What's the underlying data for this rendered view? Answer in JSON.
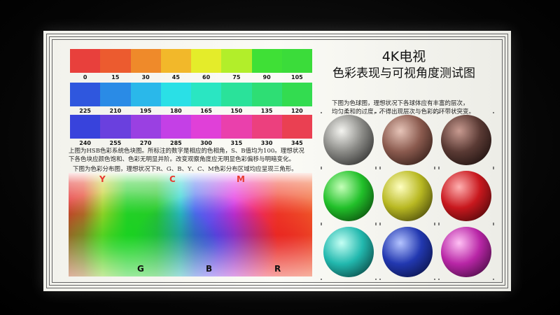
{
  "chart": {
    "title_line1": "4K电视",
    "title_line2": "色彩表现与可视角度测试图",
    "hue_rows": [
      {
        "labels": [
          "0",
          "15",
          "30",
          "45",
          "60",
          "75",
          "90",
          "105"
        ],
        "colors": [
          "#e8403c",
          "#ec5b2f",
          "#ef8a2a",
          "#f2b82a",
          "#e4ec2a",
          "#b2ee2a",
          "#3fe036",
          "#3bdc3a"
        ]
      },
      {
        "labels": [
          "225",
          "210",
          "195",
          "180",
          "165",
          "150",
          "135",
          "120"
        ],
        "colors": [
          "#2f57de",
          "#2a8be6",
          "#2ab8ea",
          "#2ae0e6",
          "#2ae6c2",
          "#2ae29a",
          "#2ede74",
          "#33dc50"
        ]
      },
      {
        "labels": [
          "240",
          "255",
          "270",
          "285",
          "300",
          "315",
          "330",
          "345"
        ],
        "colors": [
          "#3843dc",
          "#6a40de",
          "#9a40e2",
          "#c440e6",
          "#e040d8",
          "#ea40ac",
          "#ec407e",
          "#ea4052"
        ]
      }
    ],
    "hsb_desc_line1": "上图为HSB色彩系统色块图。所标注的数字是相应的色相角，S、B值均为100。理想状况",
    "hsb_desc_line2": "下各色块应颜色饱和、色彩无明显并阶。改变观察角度应无明显色彩偏移与明暗变化。",
    "dist_desc": "下图为色彩分布图，理想状况下R、G、B、Y、C、M色彩分布区域均应呈现三角形。",
    "dist_labels": {
      "y": "Y",
      "c": "C",
      "m": "M",
      "g": "G",
      "b": "B",
      "r": "R"
    },
    "dist_label_colors": {
      "y": "#e83a30",
      "c": "#e83a30",
      "m": "#e83a30",
      "g": "#111111",
      "b": "#111111",
      "r": "#111111"
    },
    "sphere_desc_line1": "下图为色球图，理想状况下各球体应有丰富的层次，",
    "sphere_desc_line2": "均匀柔和的过度，不得出现层次与色彩的环带状突变。",
    "spheres": [
      {
        "name": "grey",
        "color": "#8a8a86",
        "hi": "#f4f4f0",
        "shadow": "#151515"
      },
      {
        "name": "skin",
        "color": "#8a5a4e",
        "hi": "#e6c4b8",
        "shadow": "#1a0c08"
      },
      {
        "name": "brown",
        "color": "#5a3a34",
        "hi": "#c89a90",
        "shadow": "#0c0504"
      },
      {
        "name": "green",
        "color": "#22c02a",
        "hi": "#c4ffb8",
        "shadow": "#042a04"
      },
      {
        "name": "yellow",
        "color": "#b8b822",
        "hi": "#ffffc0",
        "shadow": "#262604"
      },
      {
        "name": "red",
        "color": "#c8181e",
        "hi": "#ffb0b0",
        "shadow": "#2c0404"
      },
      {
        "name": "cyan",
        "color": "#22b8ae",
        "hi": "#c4fff4",
        "shadow": "#042826"
      },
      {
        "name": "blue",
        "color": "#2238b0",
        "hi": "#b4c4ff",
        "shadow": "#04082a"
      },
      {
        "name": "magenta",
        "color": "#b826a6",
        "hi": "#ffc0f4",
        "shadow": "#280426"
      }
    ]
  }
}
